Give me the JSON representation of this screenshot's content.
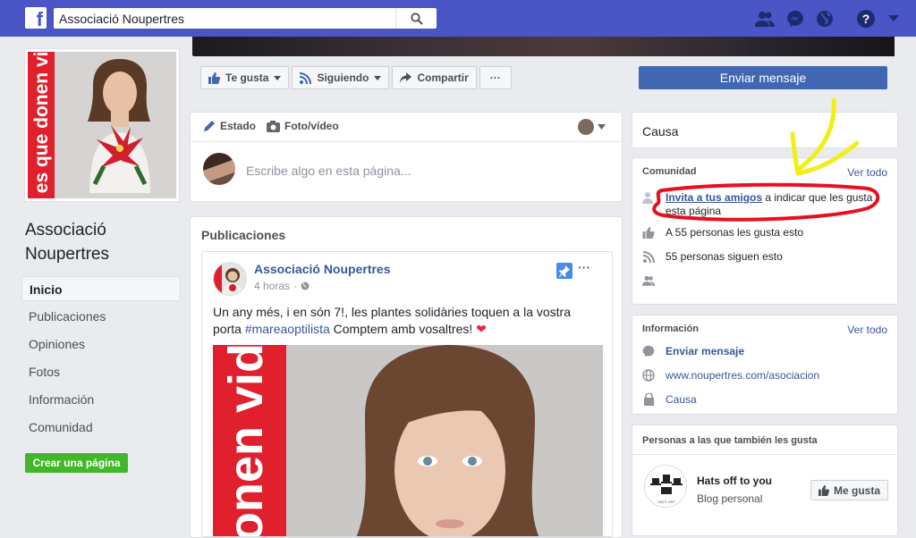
{
  "topbar": {
    "logo": "f",
    "search_value": "Associació Noupertres",
    "icons": [
      "friends-icon",
      "messenger-icon",
      "globe-icon",
      "help-icon",
      "caret-down-icon"
    ]
  },
  "profile": {
    "pic_text": "es que donen vida",
    "page_name": "Associació Noupertres"
  },
  "left_nav": {
    "items": [
      {
        "label": "Inicio",
        "active": true
      },
      {
        "label": "Publicaciones"
      },
      {
        "label": "Opiniones"
      },
      {
        "label": "Fotos"
      },
      {
        "label": "Información"
      },
      {
        "label": "Comunidad"
      }
    ],
    "create_page": "Crear una página"
  },
  "action_bar": {
    "like": "Te gusta",
    "following": "Siguiendo",
    "share": "Compartir",
    "more": "···",
    "send_message": "Enviar mensaje"
  },
  "composer": {
    "tab_status": "Estado",
    "tab_photo": "Foto/vídeo",
    "placeholder": "Escribe algo en esta página..."
  },
  "publications": {
    "title": "Publicaciones",
    "post": {
      "author": "Associació Noupertres",
      "time": "4 horas",
      "text_before": "Un any més, i en són 7!, les plantes solidàries toquen a la vostra porta ",
      "hashtag": "#mareaoptilista",
      "text_after": " Comptem amb vosaltres! ",
      "heart": "❤",
      "image_text": "onen vida"
    }
  },
  "right": {
    "cause": "Causa",
    "community": {
      "title": "Comunidad",
      "see_all": "Ver todo",
      "invite_link": "Invita a tus amigos",
      "invite_rest": " a indicar que les gusta esta página",
      "likes": "A 55 personas les gusta esto",
      "follows": "55 personas siguen esto"
    },
    "info": {
      "title": "Información",
      "see_all": "Ver todo",
      "send_message": "Enviar mensaje",
      "website": "www.noupertres.com/asociacion",
      "category": "Causa"
    },
    "also_like": {
      "title": "Personas a las que también les gusta",
      "page_name": "Hats off to you",
      "page_category": "Blog personal",
      "like_button": "Me gusta"
    }
  },
  "colors": {
    "topbar": "#4a56c6",
    "link": "#365899",
    "primary_button": "#4267b2",
    "create_button": "#42b72a",
    "annotation_red": "#e8101c",
    "annotation_yellow": "#f2ee1a"
  }
}
